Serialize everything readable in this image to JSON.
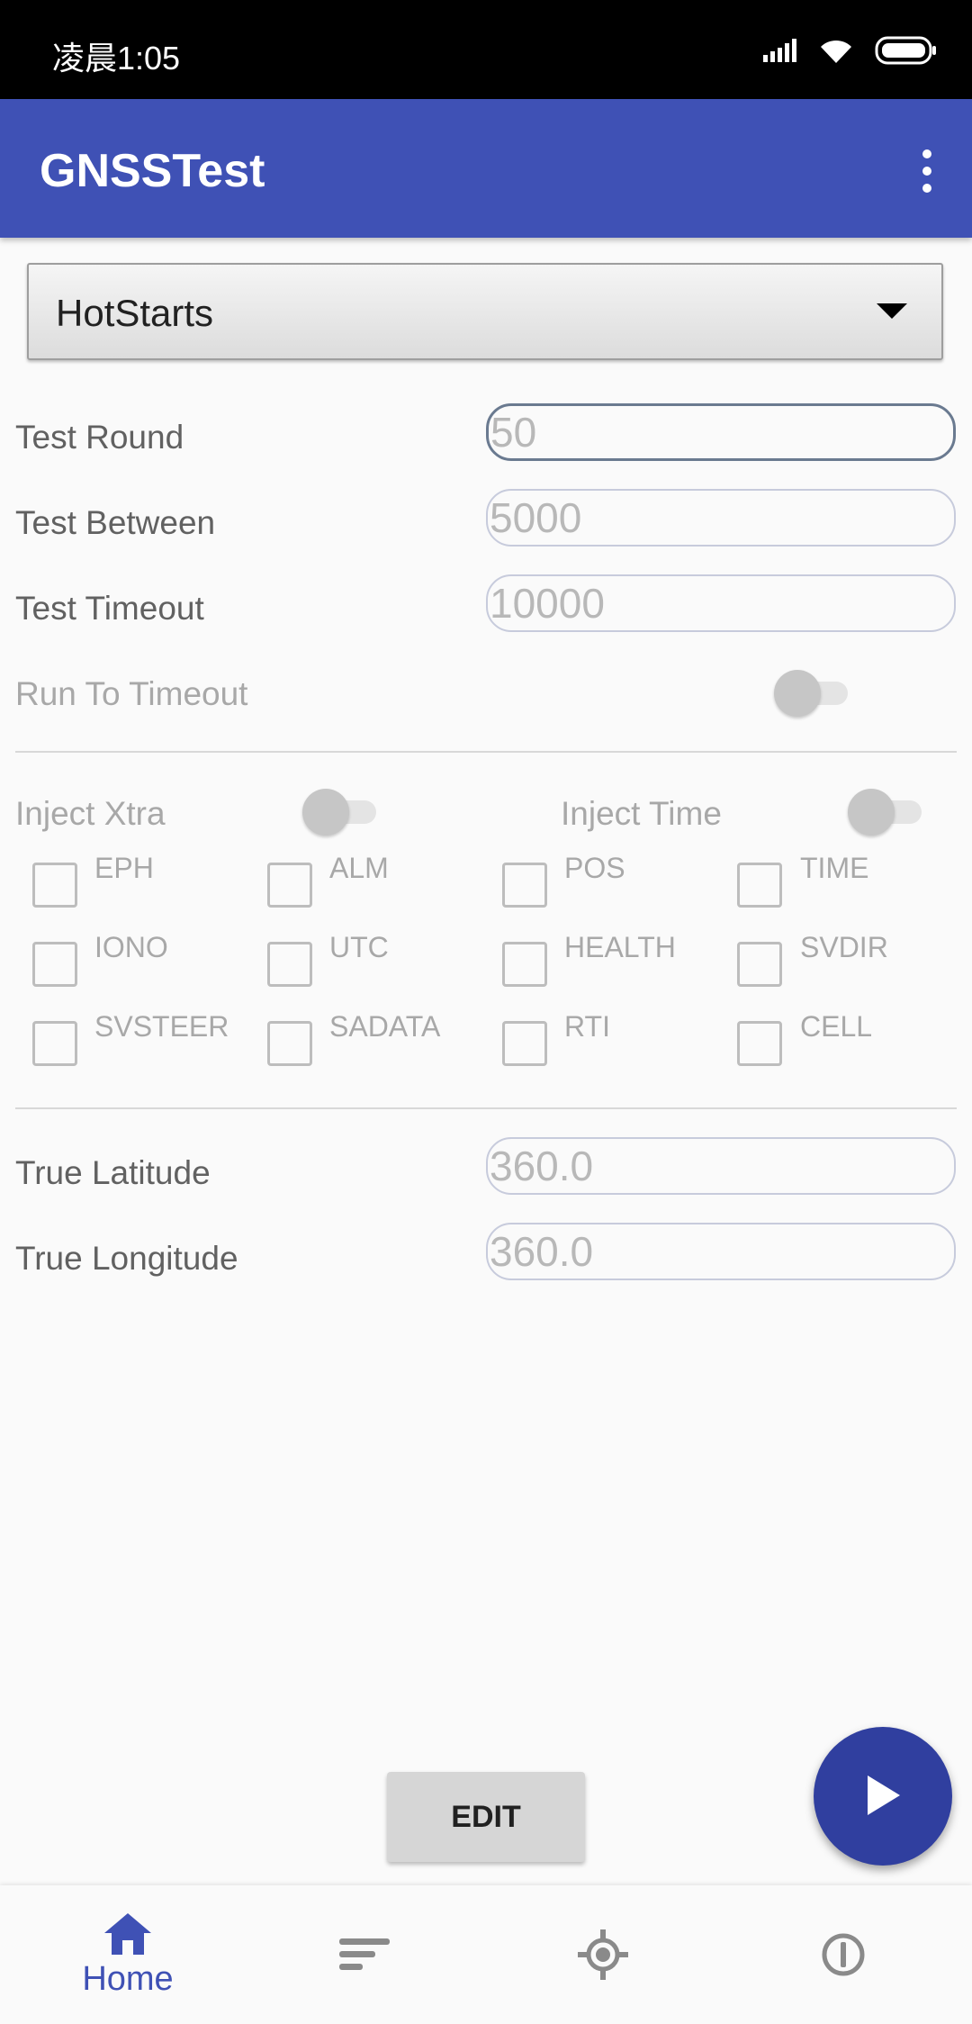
{
  "status_bar": {
    "time": "凌晨1:05"
  },
  "app_bar": {
    "title": "GNSSTest"
  },
  "mode_spinner": {
    "selected": "HotStarts"
  },
  "settings": {
    "test_round": {
      "label": "Test Round",
      "value": "50"
    },
    "test_between": {
      "label": "Test Between",
      "value": "5000"
    },
    "test_timeout": {
      "label": "Test Timeout",
      "value": "10000"
    },
    "run_to_timeout": {
      "label": "Run To Timeout",
      "on": false
    }
  },
  "inject": {
    "xtra": {
      "label": "Inject Xtra",
      "on": false
    },
    "time": {
      "label": "Inject Time",
      "on": false
    },
    "options": [
      "EPH",
      "ALM",
      "POS",
      "TIME",
      "IONO",
      "UTC",
      "HEALTH",
      "SVDIR",
      "SVSTEER",
      "SADATA",
      "RTI",
      "CELL"
    ]
  },
  "true_position": {
    "latitude": {
      "label": "True Latitude",
      "value": "360.0"
    },
    "longitude": {
      "label": "True Longitude",
      "value": "360.0"
    }
  },
  "buttons": {
    "edit": "EDIT"
  },
  "bottom_nav": {
    "home_label": "Home",
    "items": [
      "home-icon",
      "list-icon",
      "gps-target-icon",
      "info-icon"
    ]
  },
  "colors": {
    "primary": "#3f51b5",
    "fab": "#303f9f"
  }
}
